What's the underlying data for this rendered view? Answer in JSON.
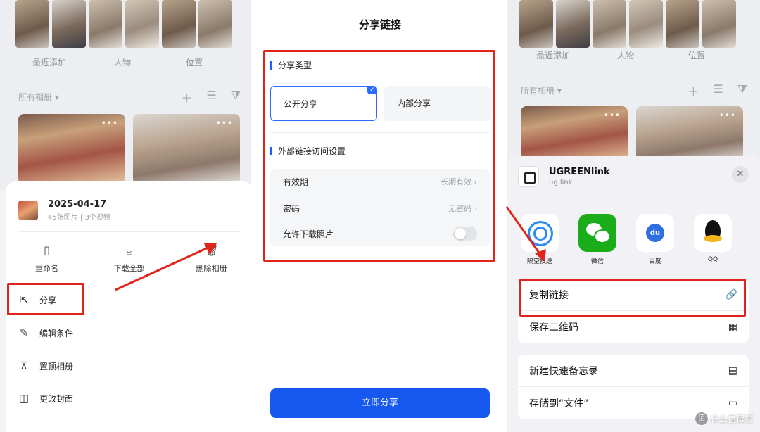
{
  "panel1": {
    "album_labels": [
      "最近添加",
      "人物",
      "位置"
    ],
    "all_albums": "所有相册",
    "more": "•••",
    "album": {
      "date": "2025-04-17",
      "meta": "45张图片 | 3个视频"
    },
    "actions": [
      {
        "icon": "rename-icon",
        "label": "重命名"
      },
      {
        "icon": "download-icon",
        "label": "下载全部"
      },
      {
        "icon": "delete-icon",
        "label": "删除相册"
      }
    ],
    "menu": [
      {
        "icon": "share-icon",
        "label": "分享"
      },
      {
        "icon": "edit-icon",
        "label": "编辑条件"
      },
      {
        "icon": "pin-top-icon",
        "label": "置顶相册"
      },
      {
        "icon": "cover-icon",
        "label": "更改封面"
      }
    ]
  },
  "panel2": {
    "title": "分享链接",
    "share_type_heading": "分享类型",
    "options": {
      "public": "公开分享",
      "internal": "内部分享"
    },
    "access_heading": "外部链接访问设置",
    "settings": [
      {
        "label": "有效期",
        "value": "长期有效"
      },
      {
        "label": "密码",
        "value": "无密码"
      },
      {
        "label": "允许下载照片",
        "toggle": false
      }
    ],
    "share_button": "立即分享"
  },
  "panel3": {
    "album_labels": [
      "最近添加",
      "人物",
      "位置"
    ],
    "all_albums": "所有相册",
    "app": {
      "name": "UGREENlink",
      "url": "ug.link"
    },
    "share_apps": [
      {
        "icon": "airdrop-icon",
        "label": "隔空投送"
      },
      {
        "icon": "wechat-icon",
        "label": "微信"
      },
      {
        "icon": "baidu-icon",
        "label": "百度"
      },
      {
        "icon": "qq-icon",
        "label": "QQ"
      }
    ],
    "actions_group1": [
      {
        "label": "复制链接",
        "icon": "link-icon"
      },
      {
        "label": "保存二维码",
        "icon": "qrcode-icon"
      }
    ],
    "actions_group2": [
      {
        "label": "新建快速备忘录",
        "icon": "memo-icon"
      },
      {
        "label": "存储到“文件”",
        "icon": "folder-icon"
      }
    ],
    "watermark": "什么值得买",
    "watermark_badge": "值"
  },
  "colors": {
    "highlight_red": "#e2231a",
    "primary_blue": "#1658f0",
    "accent_blue": "#2b6bff"
  }
}
